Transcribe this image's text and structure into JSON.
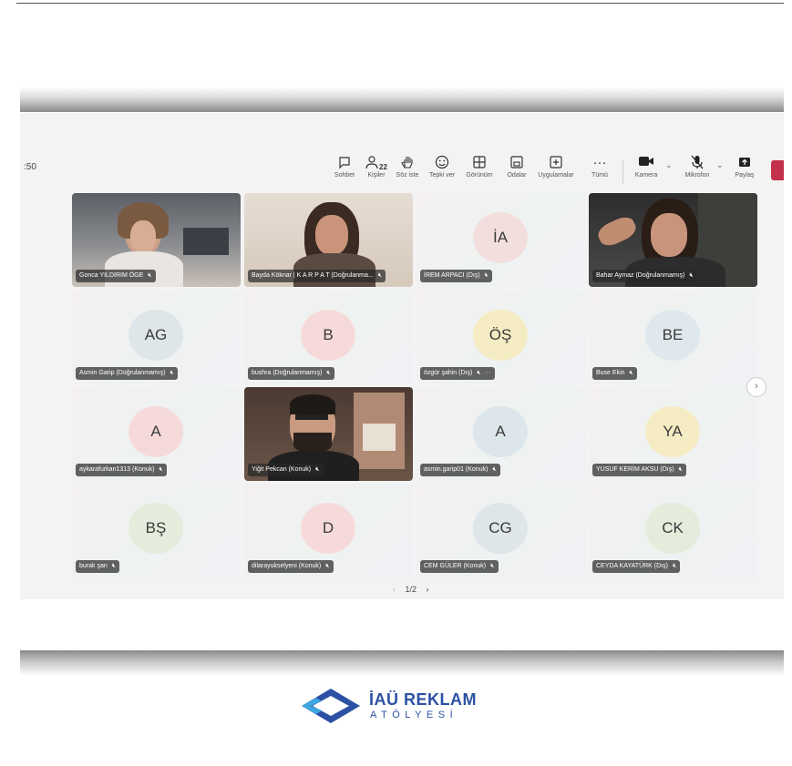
{
  "toolbar": {
    "timer": ":50",
    "chat_label": "Sohbet",
    "people_label": "Kişiler",
    "people_count": "22",
    "raise_label": "Söz iste",
    "react_label": "Tepki ver",
    "view_label": "Görünüm",
    "rooms_label": "Odalar",
    "apps_label": "Uygulamalar",
    "more_label": "Tümü",
    "camera_label": "Kamera",
    "mic_label": "Mikrofon",
    "share_label": "Paylaş"
  },
  "participants": [
    {
      "name": "Gonca YILDIRIM ÖGE",
      "type": "video"
    },
    {
      "name": "Bayda Köknar | K A R P A T (Doğrulanma...",
      "type": "video"
    },
    {
      "name": "İREM ARPACI (Dış)",
      "initials": "İA",
      "avatar_color": "#f3dede"
    },
    {
      "name": "Bahar Aymaz (Doğrulanmamış)",
      "type": "video",
      "active": true
    },
    {
      "name": "Asmin Garip (Doğrulanmamış)",
      "initials": "AG",
      "avatar_color": "#dfe6ea"
    },
    {
      "name": "bushra (Doğrulanmamış)",
      "initials": "B",
      "avatar_color": "#f6dada"
    },
    {
      "name": "özgür şahin (Dış)",
      "initials": "ÖŞ",
      "avatar_color": "#f6ecc4",
      "more": "···"
    },
    {
      "name": "Buse Ekin",
      "initials": "BE",
      "avatar_color": "#dfe8ec"
    },
    {
      "name": "aykarafurkan1313 (Konuk)",
      "initials": "A",
      "avatar_color": "#f6dada"
    },
    {
      "name": "Yiğit Pekcan (Konuk)",
      "type": "video"
    },
    {
      "name": "asmin.garip01 (Konuk)",
      "initials": "A",
      "avatar_color": "#dde6ea"
    },
    {
      "name": "YUSUF KERİM AKSU (Dış)",
      "initials": "YA",
      "avatar_color": "#f6ecc4"
    },
    {
      "name": "burak şan",
      "initials": "BŞ",
      "avatar_color": "#e4ecdc"
    },
    {
      "name": "dilarayukselyeni (Konuk)",
      "initials": "D",
      "avatar_color": "#f6dada"
    },
    {
      "name": "CEM GÜLER (Konuk)",
      "initials": "CG",
      "avatar_color": "#dfe6ea"
    },
    {
      "name": "CEYDA KAYATÜRK (Dış)",
      "initials": "CK",
      "avatar_color": "#e4ecdc"
    }
  ],
  "pagination": {
    "prev": "‹",
    "page": "1/2",
    "next": "›"
  },
  "logo": {
    "title": "İAÜ REKLAM",
    "subtitle": "ATÖLYESİ"
  },
  "colors": {
    "accent": "#7b7fd1",
    "leave": "#c4314b",
    "brand": "#2c51a4"
  }
}
